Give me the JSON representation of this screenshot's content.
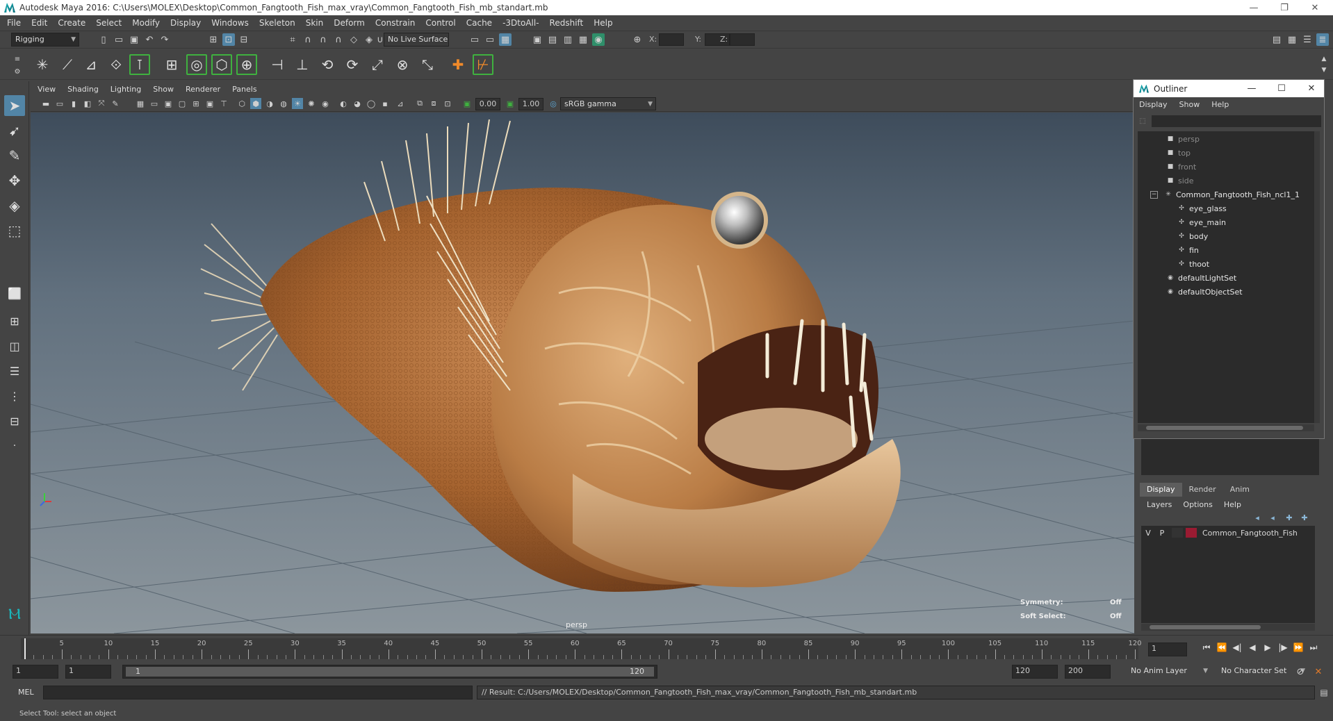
{
  "window": {
    "title": "Autodesk Maya 2016: C:\\Users\\MOLEX\\Desktop\\Common_Fangtooth_Fish_max_vray\\Common_Fangtooth_Fish_mb_standart.mb",
    "minimize": "—",
    "restore": "❐",
    "close": "✕"
  },
  "menubar": [
    "File",
    "Edit",
    "Create",
    "Select",
    "Modify",
    "Display",
    "Windows",
    "Skeleton",
    "Skin",
    "Deform",
    "Constrain",
    "Control",
    "Cache",
    "-3DtoAll-",
    "Redshift",
    "Help"
  ],
  "statusline": {
    "menuset": "Rigging",
    "live_surface": "No Live Surface",
    "x_label": "X:",
    "y_label": "Y:",
    "z_label": "Z:"
  },
  "panel": {
    "menus": [
      "View",
      "Shading",
      "Lighting",
      "Show",
      "Renderer",
      "Panels"
    ],
    "exposure": "0.00",
    "gamma": "1.00",
    "color_space": "sRGB gamma",
    "camera": "persp",
    "symmetry_label": "Symmetry:",
    "symmetry_value": "Off",
    "soft_select_label": "Soft Select:",
    "soft_select_value": "Off"
  },
  "outliner": {
    "title": "Outliner",
    "menus": [
      "Display",
      "Show",
      "Help"
    ],
    "items": [
      {
        "label": "persp",
        "dim": true,
        "icon": "camera-icon"
      },
      {
        "label": "top",
        "dim": true,
        "icon": "camera-icon"
      },
      {
        "label": "front",
        "dim": true,
        "icon": "camera-icon"
      },
      {
        "label": "side",
        "dim": true,
        "icon": "camera-icon"
      },
      {
        "label": "Common_Fangtooth_Fish_ncl1_1",
        "dim": false,
        "icon": "group-icon"
      },
      {
        "label": "eye_glass",
        "dim": false,
        "icon": "mesh-icon"
      },
      {
        "label": "eye_main",
        "dim": false,
        "icon": "mesh-icon"
      },
      {
        "label": "body",
        "dim": false,
        "icon": "mesh-icon"
      },
      {
        "label": "fin",
        "dim": false,
        "icon": "mesh-icon"
      },
      {
        "label": "thoot",
        "dim": false,
        "icon": "mesh-icon"
      },
      {
        "label": "defaultLightSet",
        "dim": false,
        "icon": "set-icon"
      },
      {
        "label": "defaultObjectSet",
        "dim": false,
        "icon": "set-icon"
      }
    ]
  },
  "layers": {
    "tabs": [
      "Display",
      "Render",
      "Anim"
    ],
    "menus": [
      "Layers",
      "Options",
      "Help"
    ],
    "row": {
      "v": "V",
      "p": "P",
      "name": "Common_Fangtooth_Fish",
      "color": "#9a1b32"
    }
  },
  "timeline": {
    "ticks": [
      1,
      5,
      10,
      15,
      20,
      25,
      30,
      35,
      40,
      45,
      50,
      55,
      60,
      65,
      70,
      75,
      80,
      85,
      90,
      95,
      100,
      105,
      110,
      115,
      120
    ],
    "current_frame": "1"
  },
  "range": {
    "start": "1",
    "playback_start": "1",
    "bar_start": "1",
    "bar_end": "120",
    "playback_end": "120",
    "end": "200",
    "anim_layer": "No Anim Layer",
    "character_set": "No Character Set"
  },
  "command": {
    "language": "MEL",
    "result": "// Result: C:/Users/MOLEX/Desktop/Common_Fangtooth_Fish_max_vray/Common_Fangtooth_Fish_mb_standart.mb"
  },
  "helpline": "Select Tool: select an object",
  "colors": {
    "accent": "#5285a6",
    "green_highlight": "#3fb13f",
    "viewport_top": "#3e4c5b",
    "viewport_bottom": "#8c969d"
  }
}
